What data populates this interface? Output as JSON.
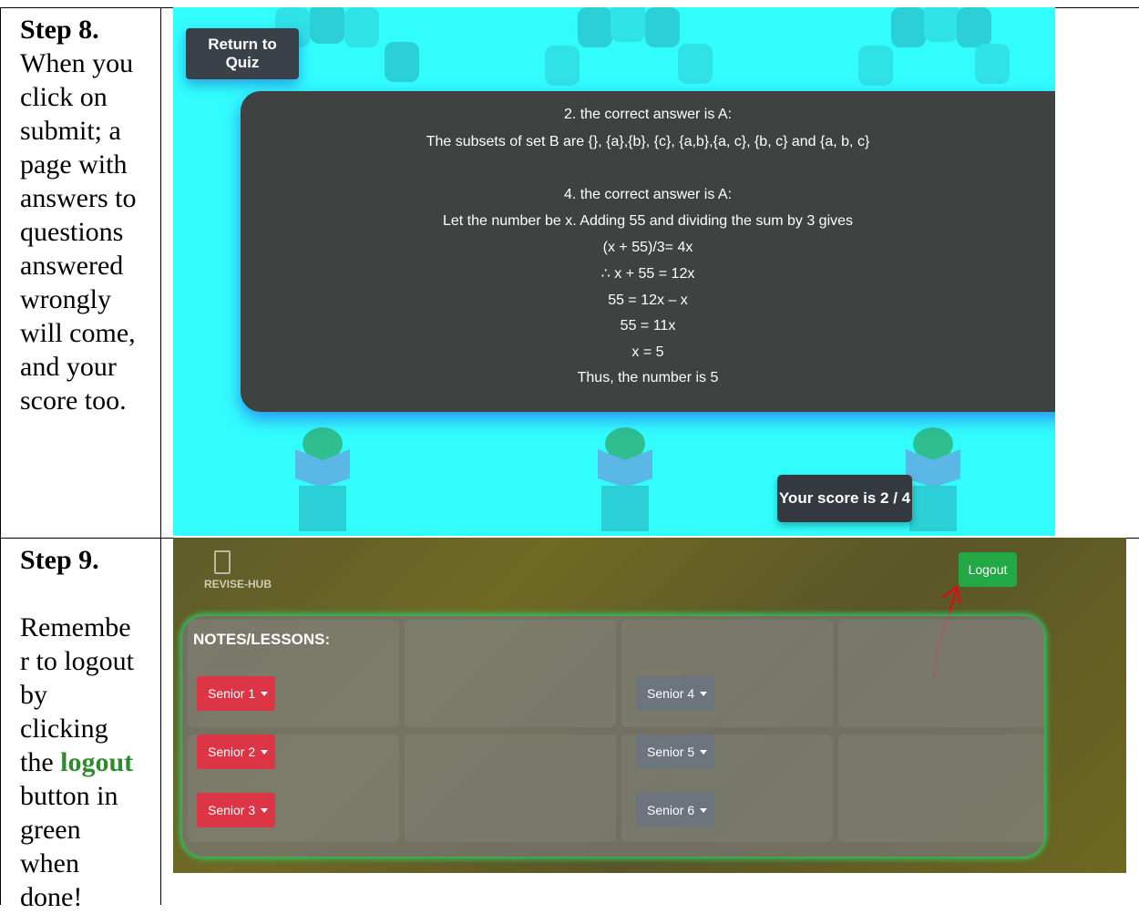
{
  "step8": {
    "title": "Step 8.",
    "lines": [
      "When you",
      "click on",
      "submit; a",
      "page with",
      "answers to",
      "questions",
      "answered",
      "wrongly",
      "will come,",
      "and your",
      "score too."
    ]
  },
  "step9": {
    "title": "Step 9.",
    "lines_before": [
      "Remembe",
      "r to logout",
      "by",
      "clicking",
      "the "
    ],
    "highlight": "logout",
    "lines_after": [
      "button in",
      "green",
      "when",
      "done!"
    ]
  },
  "quiz_screen": {
    "return_button": "Return to Quiz",
    "answers": [
      "2. the correct answer is A:",
      "The subsets of set B are {}, {a},{b}, {c}, {a,b},{a, c}, {b, c} and {a, b, c}",
      "",
      "4. the correct answer is A:",
      "Let the number be x. Adding 55 and dividing the sum by 3 gives",
      "(x + 55)/3= 4x",
      "∴ x + 55 = 12x",
      "55 = 12x – x",
      "55 = 11x",
      "x = 5",
      "Thus, the number is 5"
    ],
    "score": "Your score is 2 / 4"
  },
  "notes_screen": {
    "logo_text": "REVISE-HUB",
    "logout_button": "Logout",
    "panel_title": "NOTES/LESSONS:",
    "seniors_left": [
      "Senior 1",
      "Senior 2",
      "Senior 3"
    ],
    "seniors_right": [
      "Senior 4",
      "Senior 5",
      "Senior 6"
    ]
  },
  "colors": {
    "quiz_bg": "#32fdfd",
    "panel_dark": "#404141",
    "logout_green": "#22a845",
    "senior_red": "#dc3545",
    "senior_gray": "#6c757d",
    "highlight_green": "#2e8b2e",
    "arrow_red": "#d31212"
  }
}
